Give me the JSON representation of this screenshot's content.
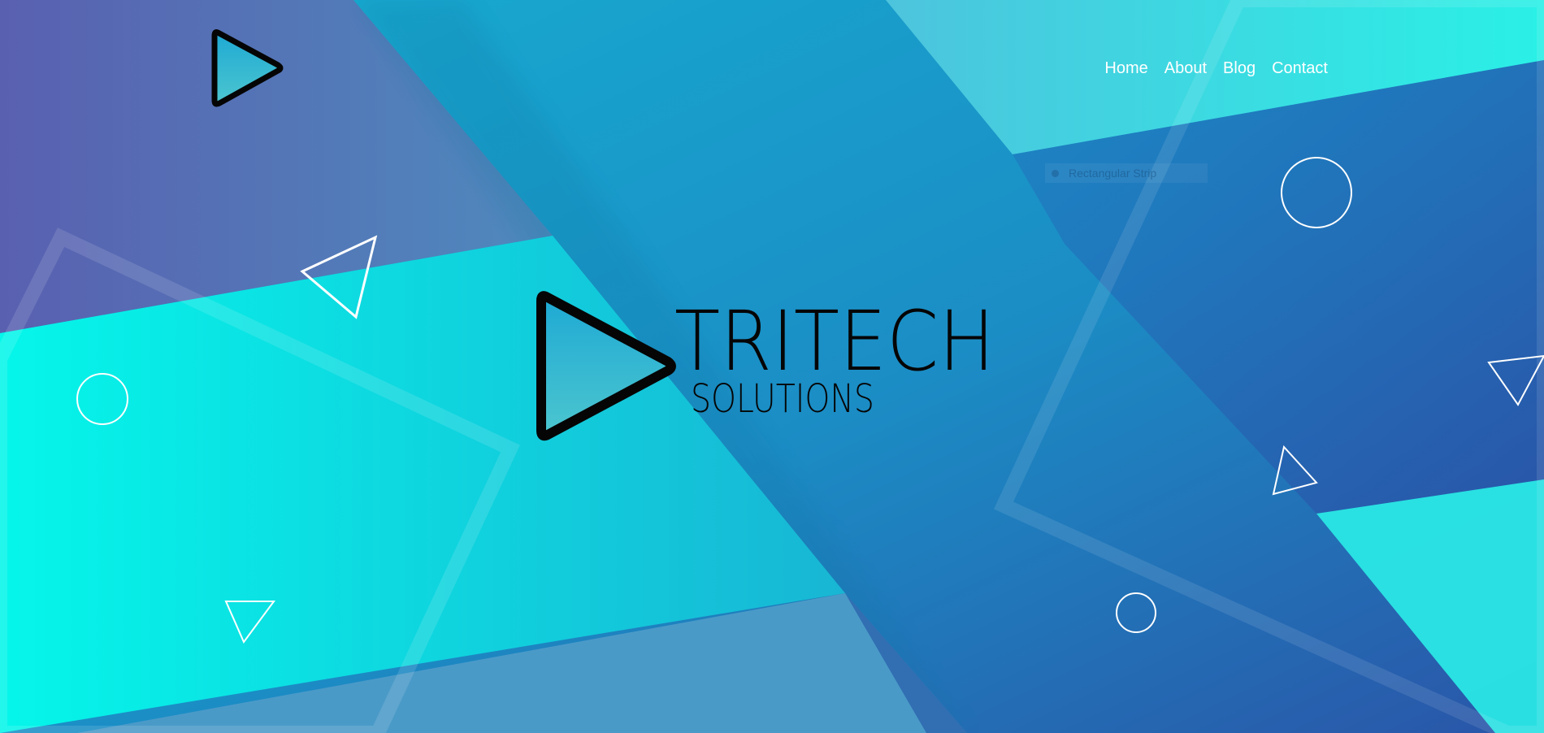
{
  "nav": {
    "items": [
      {
        "label": "Home"
      },
      {
        "label": "About"
      },
      {
        "label": "Blog"
      },
      {
        "label": "Contact"
      }
    ]
  },
  "brand": {
    "name_line1": "TRITECH",
    "name_line2": "SOLUTIONS"
  },
  "overlay": {
    "faint_label": "Rectangular Strip"
  },
  "decor_icons": [
    "triangle-outline-icon",
    "circle-outline-icon"
  ],
  "colors": {
    "purple": "#5b5db1",
    "teal": "#19b4d4",
    "cyan": "#08f0e8",
    "blue": "#2b58aa",
    "white_lines": "#ffffff",
    "logo_black": "#050505"
  }
}
